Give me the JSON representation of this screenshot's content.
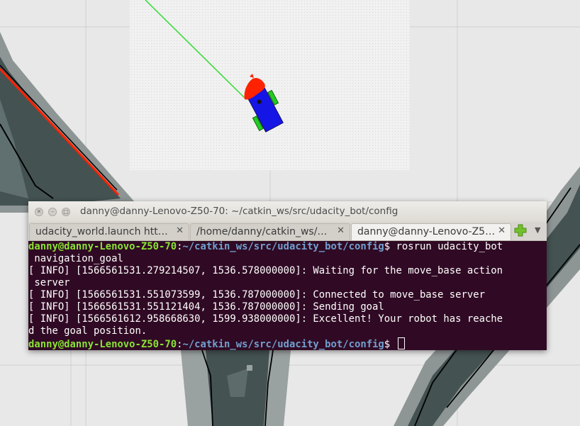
{
  "terminal": {
    "window_title": "danny@danny-Lenovo-Z50-70: ~/catkin_ws/src/udacity_bot/config",
    "tabs": [
      {
        "label": "udacity_world.launch htt…",
        "active": false
      },
      {
        "label": "/home/danny/catkin_ws/…",
        "active": false
      },
      {
        "label": "danny@danny-Lenovo-Z5…",
        "active": true
      }
    ],
    "prompt_user": "danny@danny-Lenovo-Z50-70",
    "prompt_path": "~/catkin_ws/src/udacity_bot/config",
    "command": "$ rosrun udacity_bot",
    "lines": [
      " navigation_goal",
      "[ INFO] [1566561531.279214507, 1536.578000000]: Waiting for the move_base action",
      " server",
      "[ INFO] [1566561531.551073599, 1536.787000000]: Connected to move_base server",
      "[ INFO] [1566561531.551121404, 1536.787000000]: Sending goal",
      "[ INFO] [1566561612.958668630, 1599.938000000]: Excellent! Your robot has reache",
      "d the goal position."
    ],
    "final_prompt_suffix": "$ "
  },
  "icons": {
    "close": "close-icon",
    "minimize": "minimize-icon",
    "maximize": "maximize-icon",
    "new_tab": "plus-icon",
    "tab_menu": "chevron-down-icon"
  },
  "colors": {
    "terminal_bg": "#300a24",
    "prompt_user": "#8ae234",
    "prompt_path": "#729fcf",
    "path_line": "#33dd33",
    "robot_body": "#1515e6",
    "robot_wheels": "#22cc22",
    "laser_scan": "#ff2200",
    "map_wall": "#2f3f3f"
  }
}
